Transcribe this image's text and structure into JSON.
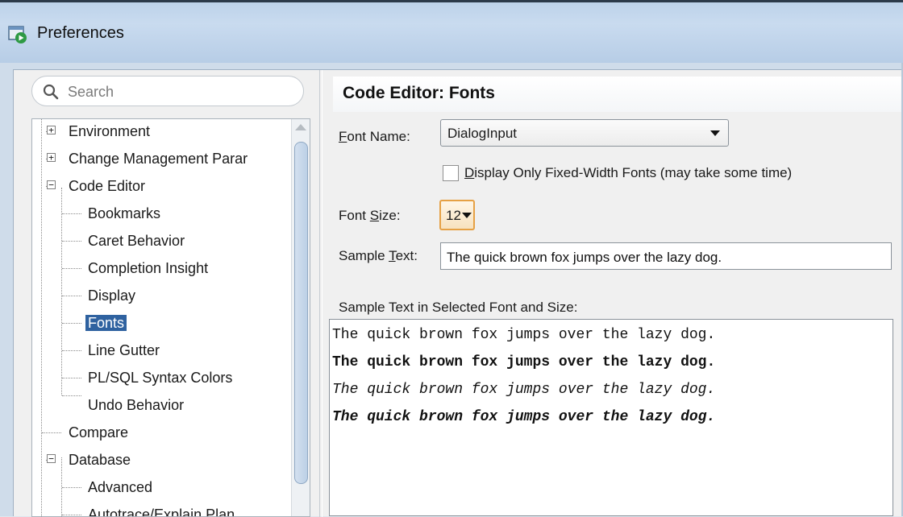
{
  "window": {
    "title": "Preferences",
    "icon": "preferences-app-icon"
  },
  "search": {
    "placeholder": "Search",
    "icon": "search-icon"
  },
  "tree": {
    "items": [
      {
        "label": "Environment",
        "level": 0,
        "expander": "+"
      },
      {
        "label": "Change Management Parar",
        "level": 0,
        "expander": "+"
      },
      {
        "label": "Code Editor",
        "level": 0,
        "expander": "-"
      },
      {
        "label": "Bookmarks",
        "level": 1
      },
      {
        "label": "Caret Behavior",
        "level": 1
      },
      {
        "label": "Completion Insight",
        "level": 1
      },
      {
        "label": "Display",
        "level": 1
      },
      {
        "label": "Fonts",
        "level": 1,
        "selected": true
      },
      {
        "label": "Line Gutter",
        "level": 1
      },
      {
        "label": "PL/SQL Syntax Colors",
        "level": 1
      },
      {
        "label": "Undo Behavior",
        "level": 1
      },
      {
        "label": "Compare",
        "level": 0
      },
      {
        "label": "Database",
        "level": 0,
        "expander": "-"
      },
      {
        "label": "Advanced",
        "level": 1
      },
      {
        "label": "Autotrace/Explain Plan",
        "level": 1
      }
    ]
  },
  "panel": {
    "title": "Code Editor: Fonts",
    "font_name": {
      "label_mnemonic": "F",
      "label_rest": "ont Name:",
      "value": "DialogInput"
    },
    "fixed_width": {
      "label_mnemonic": "D",
      "label_rest": "isplay Only Fixed-Width Fonts (may take some time)",
      "checked": false
    },
    "font_size": {
      "label_pre": "Font ",
      "label_mnemonic": "S",
      "label_rest": "ize:",
      "value": "12"
    },
    "sample_text": {
      "label_pre": "Sample ",
      "label_mnemonic": "T",
      "label_rest": "ext:",
      "value": "The quick brown fox jumps over the lazy dog."
    },
    "preview_label": "Sample Text in Selected Font and Size:",
    "preview_lines": [
      "The quick brown fox jumps over the lazy dog.",
      "The quick brown fox jumps over the lazy dog.",
      "The quick brown fox jumps over the lazy dog.",
      "The quick brown fox jumps over the lazy dog."
    ]
  },
  "colors": {
    "selection": "#2f62a0",
    "focus_border": "#e6a145",
    "titlebar": "#bcd2ea"
  }
}
